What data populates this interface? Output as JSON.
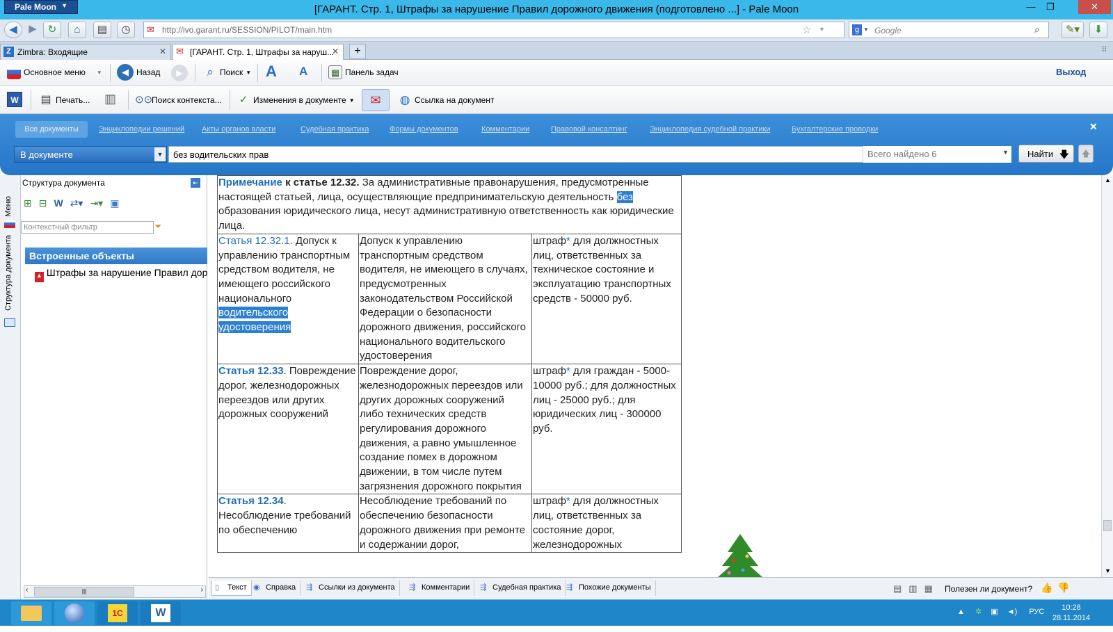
{
  "window": {
    "app_menu": "Pale Moon",
    "title": "[ГАРАНТ. Стр. 1, Штрафы за нарушение Правил дорожного движения (подготовлено ...] - Pale Moon",
    "controls": {
      "minimize": "—",
      "maximize": "❐",
      "close": "✕"
    }
  },
  "navigation": {
    "url": "http://ivo.garant.ru/SESSION/PILOT/main.htm",
    "search_placeholder": "Google"
  },
  "tabs": [
    {
      "label": "Zimbra: Входящие",
      "active": false
    },
    {
      "label": "[ГАРАНТ. Стр. 1, Штрафы за наруш...",
      "active": true
    }
  ],
  "toolbar1": {
    "main_menu": "Основное меню",
    "back": "Назад",
    "search": "Поиск",
    "taskbar_panel": "Панель задач",
    "exit": "Выход"
  },
  "toolbar2": {
    "print": "Печать...",
    "context_search": "Поиск контекста...",
    "doc_changes": "Изменения в документе",
    "doc_link": "Ссылка на документ"
  },
  "search_panel": {
    "sections": [
      "Все документы",
      "Энциклопедии решений",
      "Акты органов власти",
      "Судебная практика",
      "Формы документов",
      "Комментарии",
      "Правовой консалтинг",
      "Энциклопедия судебной практики",
      "Бухгалтерские проводки"
    ],
    "scope": "В документе",
    "query": "без водительских прав",
    "found": "Всего найдено 6",
    "find_button": "Найти"
  },
  "left_vtabs": {
    "menu": "Меню",
    "structure": "Структура документа"
  },
  "structure_panel": {
    "title": "Структура документа",
    "filter_placeholder": "Контекстный фильтр",
    "builtin_header": "Встроенные объекты",
    "tree_item": "Штрафы за нарушение Правил дорожного движения"
  },
  "document": {
    "note": {
      "link": "Примечание",
      "bold": " к статье 12.32.",
      "text_before": " За административные правонарушения, предусмотренные настоящей статьей, лица, осуществляющие предпринимательскую деятельность ",
      "highlight": "без",
      "text_after": " образования юридического лица, несут административную ответственность как юридические лица."
    },
    "rows": [
      {
        "article": "Статья 12.32.1.",
        "article_bold": false,
        "col1_text": " Допуск к управлению транспортным средством водителя, не имеющего российского национального ",
        "col1_highlight": "водительского удостоверения",
        "col2": "Допуск к управлению транспортным средством водителя, не имеющего в случаях, предусмотренных законодательством Российской Федерации о безопасности дорожного движения, российского национального водительского удостоверения",
        "penalty_word": "штраф",
        "col3": " для должностных лиц, ответственных за техническое состояние и эксплуатацию транспортных средств - 50000 руб."
      },
      {
        "article": "Статья 12.33",
        "article_bold": true,
        "col1_text": ". Повреждение дорог, железнодорожных переездов или других дорожных сооружений",
        "col1_highlight": "",
        "col2": "Повреждение дорог, железнодорожных переездов или других дорожных сооружений либо технических средств регулирования дорожного движения, а равно умышленное создание помех в дорожном движении, в том числе путем загрязнения дорожного покрытия",
        "penalty_word": "штраф",
        "col3": " для граждан - 5000-10000 руб.; для должностных лиц - 25000 руб.; для юридических лиц - 300000 руб."
      },
      {
        "article": "Статья 12.34",
        "article_bold": true,
        "col1_text": ". Несоблюдение требований по обеспечению",
        "col1_highlight": "",
        "col2": "Несоблюдение требований по обеспечению безопасности дорожного движения при ремонте и содержании дорог,",
        "penalty_word": "штраф",
        "col3": " для должностных лиц, ответственных за состояние дорог, железнодорожных"
      }
    ]
  },
  "bottom_tabs": [
    "Текст",
    "Справка",
    "Ссылки из документа",
    "Комментарии",
    "Судебная практика",
    "Похожие документы"
  ],
  "feedback": "Полезен ли документ?",
  "taskbar": {
    "apps": [
      "Explorer",
      "Pale Moon",
      "1C v8",
      "Word"
    ],
    "lang": "РУС",
    "time": "10:28",
    "date": "28.11.2014"
  }
}
